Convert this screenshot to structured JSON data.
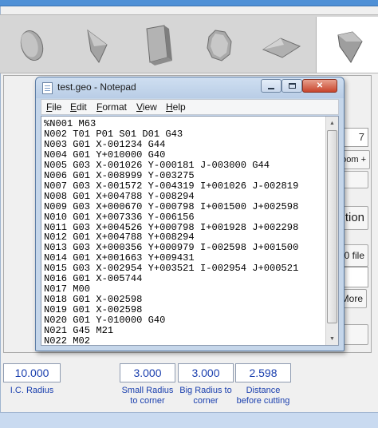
{
  "app": {
    "shape_buttons": [
      {
        "name": "round-insert",
        "selected": false
      },
      {
        "name": "triangle-insert",
        "selected": false
      },
      {
        "name": "square-insert",
        "selected": false
      },
      {
        "name": "octagon-insert",
        "selected": false
      },
      {
        "name": "diamond-insert",
        "selected": false
      },
      {
        "name": "trigon-insert",
        "selected": true
      }
    ],
    "background_controls": {
      "zoom_button": "oom +",
      "action_button": "tion",
      "file_button": "0 file",
      "more_button": "More",
      "field_value": "7"
    }
  },
  "values": {
    "ic_radius": {
      "value": "10.000",
      "label_line1": "I.C. Radius",
      "label_line2": ""
    },
    "small_radius": {
      "value": "3.000",
      "label_line1": "Small Radius",
      "label_line2": "to corner"
    },
    "big_radius": {
      "value": "3.000",
      "label_line1": "Big Radius to",
      "label_line2": "corner"
    },
    "distance": {
      "value": "2.598",
      "label_line1": "Distance",
      "label_line2": "before cutting"
    }
  },
  "notepad": {
    "title": "test.geo - Notepad",
    "menu": [
      {
        "label": "File",
        "accel": "F",
        "rest": "ile"
      },
      {
        "label": "Edit",
        "accel": "E",
        "rest": "dit"
      },
      {
        "label": "Format",
        "accel": "F",
        "rest": "ormat"
      },
      {
        "label": "View",
        "accel": "V",
        "rest": "iew"
      },
      {
        "label": "Help",
        "accel": "H",
        "rest": "elp"
      }
    ],
    "content": "%N001 M63\nN002 T01 P01 S01 D01 G43\nN003 G01 X-001234 G44\nN004 G01 Y+010000 G40\nN005 G03 X-001026 Y-000181 J-003000 G44\nN006 G01 X-008999 Y-003275\nN007 G03 X-001572 Y-004319 I+001026 J-002819\nN008 G01 X+004788 Y-008294\nN009 G03 X+000670 Y-000798 I+001500 J+002598\nN010 G01 X+007336 Y-006156\nN011 G03 X+004526 Y+000798 I+001928 J+002298\nN012 G01 X+004788 Y+008294\nN013 G03 X+000356 Y+000979 I-002598 J+001500\nN014 G01 X+001663 Y+009431\nN015 G03 X-002954 Y+003521 I-002954 J+000521\nN016 G01 X-005744\nN017 M00\nN018 G01 X-002598\nN019 G01 X-002598\nN020 G01 Y-010000 G40\nN021 G45 M21\nN022 M02"
  }
}
